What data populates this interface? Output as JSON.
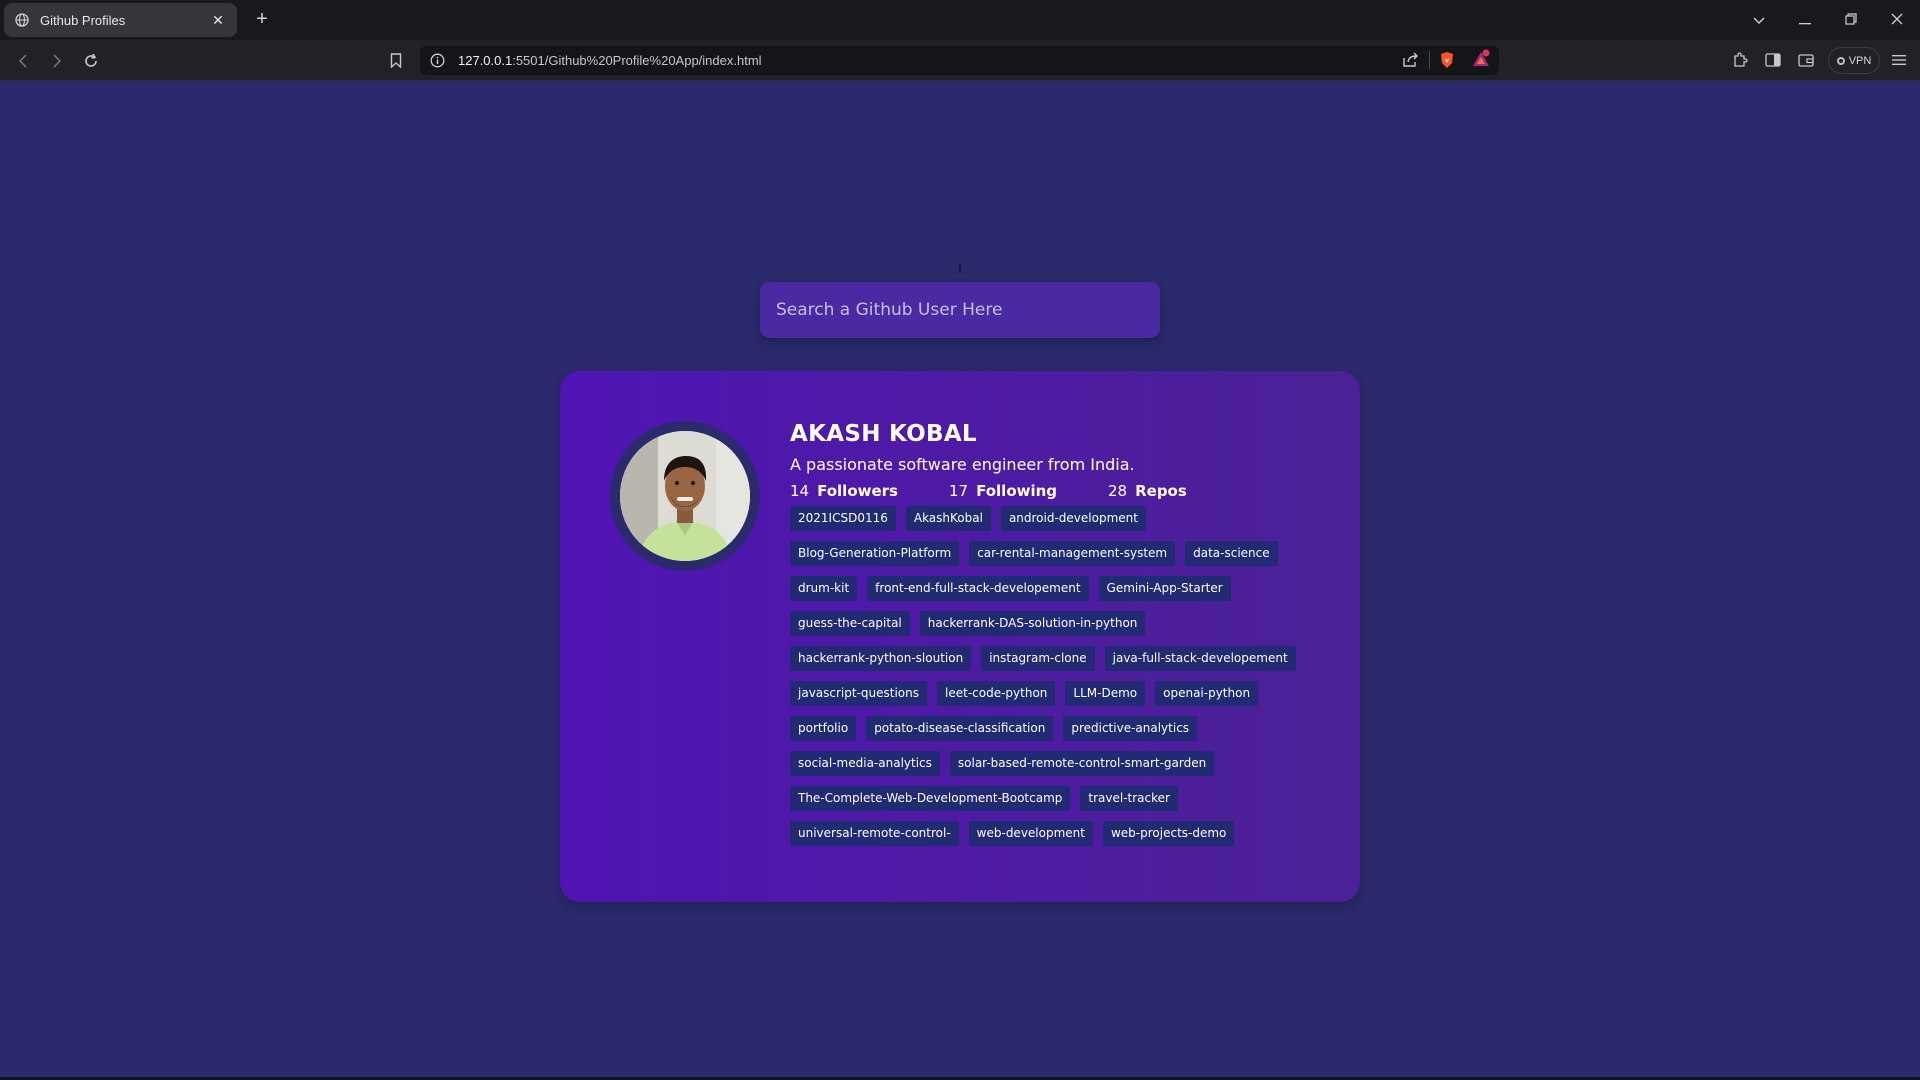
{
  "browser": {
    "tab_title": "Github Profiles",
    "url_host": "127.0.0.1",
    "url_rest": ":5501/Github%20Profile%20App/index.html",
    "vpn_label": "VPN",
    "new_tab_glyph": "+",
    "close_glyph": "✕"
  },
  "page": {
    "cursor_mark": "I",
    "search_placeholder": "Search a Github User Here"
  },
  "profile": {
    "name": "AKASH KOBAL",
    "bio": "A passionate software engineer from India.",
    "followers_count": "14",
    "followers_label": "Followers",
    "following_count": "17",
    "following_label": "Following",
    "repos_count": "28",
    "repos_label": "Repos",
    "repos": [
      "2021ICSD0116",
      "AkashKobal",
      "android-development",
      "Blog-Generation-Platform",
      "car-rental-management-system",
      "data-science",
      "drum-kit",
      "front-end-full-stack-developement",
      "Gemini-App-Starter",
      "guess-the-capital",
      "hackerrank-DAS-solution-in-python",
      "hackerrank-python-sloution",
      "instagram-clone",
      "java-full-stack-developement",
      "javascript-questions",
      "leet-code-python",
      "LLM-Demo",
      "openai-python",
      "portfolio",
      "potato-disease-classification",
      "predictive-analytics",
      "social-media-analytics",
      "solar-based-remote-control-smart-garden",
      "The-Complete-Web-Development-Bootcamp",
      "travel-tracker",
      "universal-remote-control-",
      "web-development",
      "web-projects-demo"
    ]
  },
  "colors": {
    "page_bg": "#2a2a6c",
    "card_gradient_start": "#4f14b3",
    "card_gradient_end": "#4c2195",
    "repo_bg": "#212a72",
    "search_bg": "#4a2aa3"
  }
}
